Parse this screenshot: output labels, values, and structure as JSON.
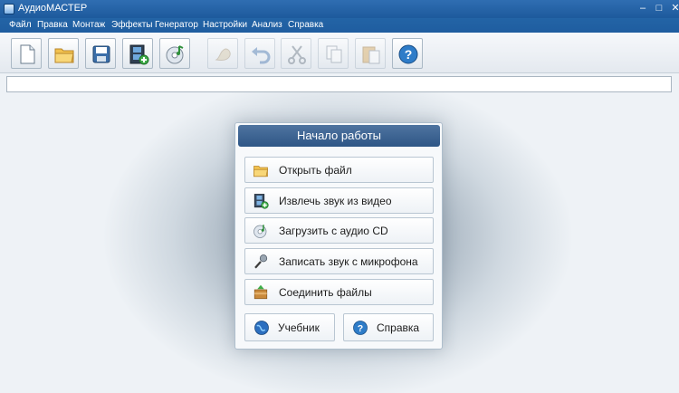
{
  "window": {
    "title": "АудиоМАСТЕР",
    "controls": {
      "minimize": "–",
      "maximize": "□",
      "close": "✕"
    }
  },
  "menu": [
    "Файл",
    "Правка",
    "Монтаж",
    "Эффекты",
    "Генератор",
    "Настройки",
    "Анализ",
    "Справка"
  ],
  "toolbar": {
    "buttons": [
      {
        "icon": "new-file-icon",
        "enabled": true
      },
      {
        "icon": "open-folder-icon",
        "enabled": true
      },
      {
        "icon": "save-icon",
        "enabled": true
      },
      {
        "icon": "extract-from-video-icon",
        "enabled": true
      },
      {
        "icon": "audio-cd-icon",
        "enabled": true
      },
      {
        "icon": "record-disabled-icon",
        "enabled": false
      },
      {
        "icon": "undo-icon",
        "enabled": false
      },
      {
        "icon": "cut-icon",
        "enabled": false
      },
      {
        "icon": "copy-icon",
        "enabled": false
      },
      {
        "icon": "paste-icon",
        "enabled": false
      },
      {
        "icon": "help-icon",
        "enabled": true
      }
    ]
  },
  "start_panel": {
    "title": "Начало работы",
    "actions": [
      {
        "label": "Открыть файл",
        "icon": "open-folder-icon"
      },
      {
        "label": "Извлечь звук из видео",
        "icon": "film-plus-icon"
      },
      {
        "label": "Загрузить с аудио CD",
        "icon": "cd-icon"
      },
      {
        "label": "Записать звук с микрофона",
        "icon": "microphone-icon"
      },
      {
        "label": "Соединить файлы",
        "icon": "join-files-icon"
      }
    ],
    "tutorial_label": "Учебник",
    "help_label": "Справка"
  }
}
